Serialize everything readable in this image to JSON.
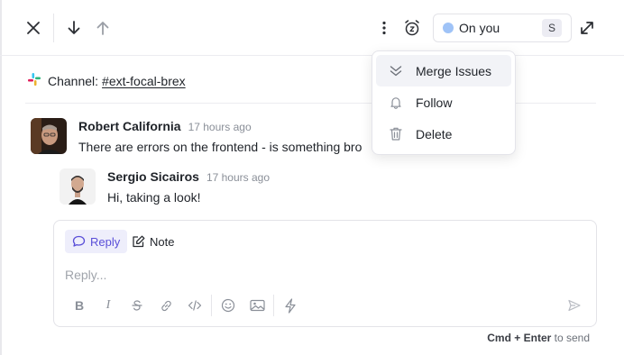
{
  "header": {
    "close_icon": "close-icon",
    "next_icon": "arrow-down-icon",
    "prev_icon": "arrow-up-icon",
    "more_icon": "more-vertical-icon",
    "snooze_icon": "snooze-clock-icon",
    "status": {
      "label": "On you",
      "shortcut": "S",
      "dot_color": "#9fc3f7"
    },
    "expand_icon": "expand-icon"
  },
  "channel": {
    "label": "Channel:",
    "link": "#ext-focal-brex"
  },
  "messages": [
    {
      "author": "Robert California",
      "time": "17 hours ago",
      "text": "There are errors on the frontend - is something bro"
    },
    {
      "author": "Sergio Sicairos",
      "time": "17 hours ago",
      "text": "Hi, taking a look!"
    }
  ],
  "composer": {
    "tabs": {
      "reply": "Reply",
      "note": "Note"
    },
    "placeholder": "Reply...",
    "toolbar": {
      "bold": "B",
      "italic": "I"
    },
    "accent": "#5a4fd8"
  },
  "send_hint": {
    "shortcut": "Cmd + Enter",
    "suffix": "to send"
  },
  "menu": {
    "items": [
      {
        "label": "Merge Issues",
        "icon": "merge-chevrons-icon"
      },
      {
        "label": "Follow",
        "icon": "bell-icon"
      },
      {
        "label": "Delete",
        "icon": "trash-icon"
      }
    ]
  }
}
